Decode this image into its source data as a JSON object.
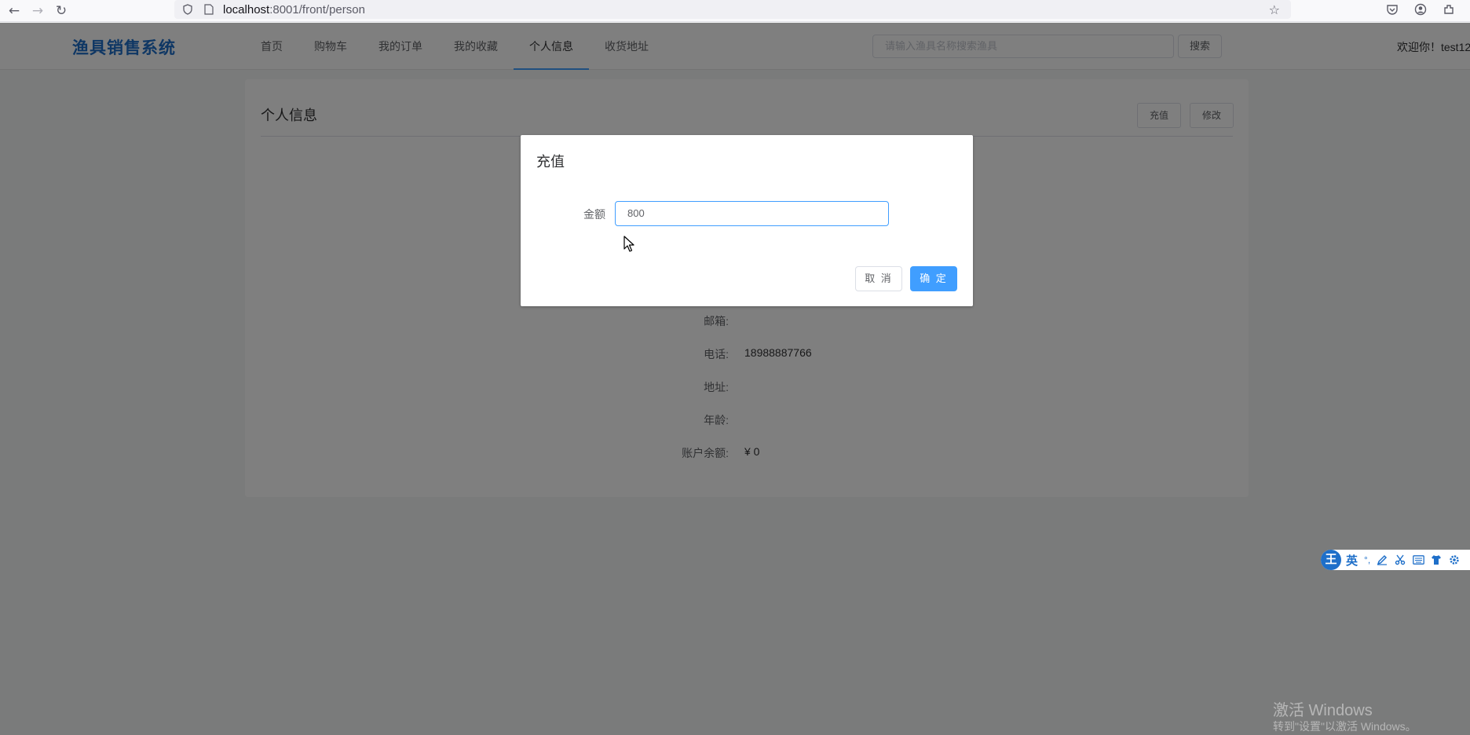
{
  "browser": {
    "url_host": "localhost",
    "url_rest": ":8001/front/person"
  },
  "header": {
    "logo": "渔具销售系统",
    "menu": [
      {
        "label": "首页"
      },
      {
        "label": "购物车"
      },
      {
        "label": "我的订单"
      },
      {
        "label": "我的收藏"
      },
      {
        "label": "个人信息",
        "active": true
      },
      {
        "label": "收货地址"
      }
    ],
    "search_placeholder": "请输入渔具名称搜索渔具",
    "search_button": "搜索",
    "welcome": "欢迎你！test12"
  },
  "card": {
    "title": "个人信息",
    "recharge_button": "充值",
    "edit_button": "修改",
    "rows": [
      {
        "label": "邮箱:",
        "value": ""
      },
      {
        "label": "电话:",
        "value": "18988887766"
      },
      {
        "label": "地址:",
        "value": ""
      },
      {
        "label": "年龄:",
        "value": ""
      },
      {
        "label": "账户余额:",
        "value": "¥ 0"
      }
    ]
  },
  "dialog": {
    "title": "充值",
    "amount_label": "金额",
    "amount_value": "800",
    "cancel_button": "取 消",
    "ok_button": "确 定"
  },
  "ime": {
    "logo": "王",
    "lang": "英",
    "punct": "°,"
  },
  "watermark": {
    "line1": "激活 Windows",
    "line2": "转到\"设置\"以激活 Windows。"
  },
  "colors": {
    "primary": "#409eff",
    "logo": "#1e6fc9",
    "overlay": "rgba(0,0,0,0.5)"
  }
}
